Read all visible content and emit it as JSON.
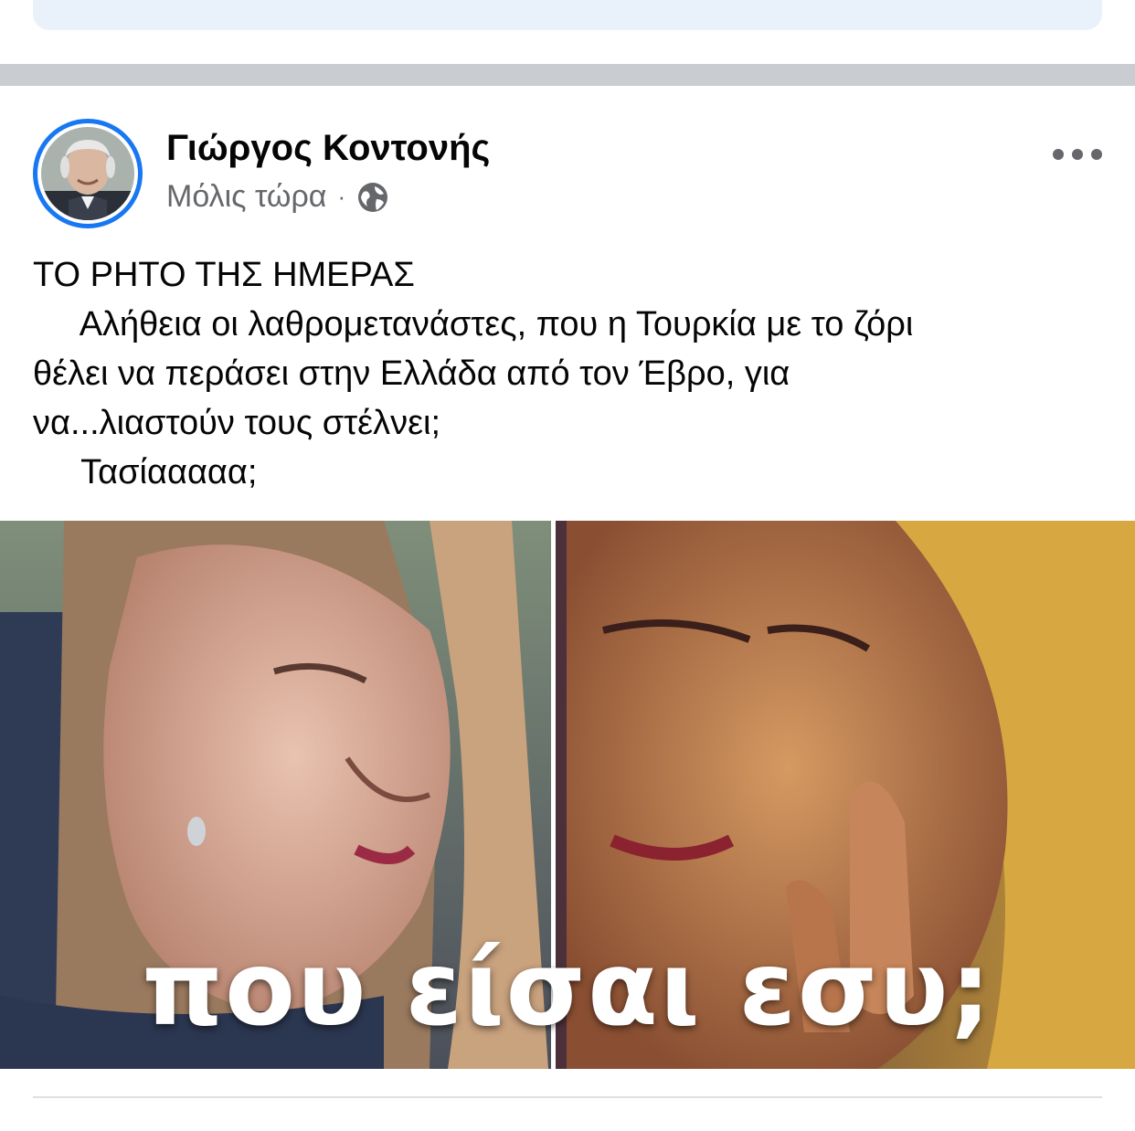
{
  "post": {
    "author": {
      "name": "Γιώργος Κοντονής",
      "avatar_icon": "profile-photo"
    },
    "timestamp": "Μόλις τώρα",
    "separator": "·",
    "audience_icon": "globe-icon",
    "text_lines": [
      "ΤΟ ΡΗΤΟ ΤΗΣ ΗΜΕΡΑΣ",
      "     Αλήθεια οι λαθρομετανάστες, που η Τουρκία με το ζόρι",
      "θέλει να περάσει στην Ελλάδα από τον Έβρο, για",
      "να...λιαστούν τους στέλνει;",
      "     Τασίααααα;"
    ],
    "image_caption": "που είσαι εσυ;"
  },
  "colors": {
    "accent": "#1877f2",
    "secondary_text": "#65676b",
    "separator": "#c9ccd1",
    "banner": "#e9f1fb"
  }
}
